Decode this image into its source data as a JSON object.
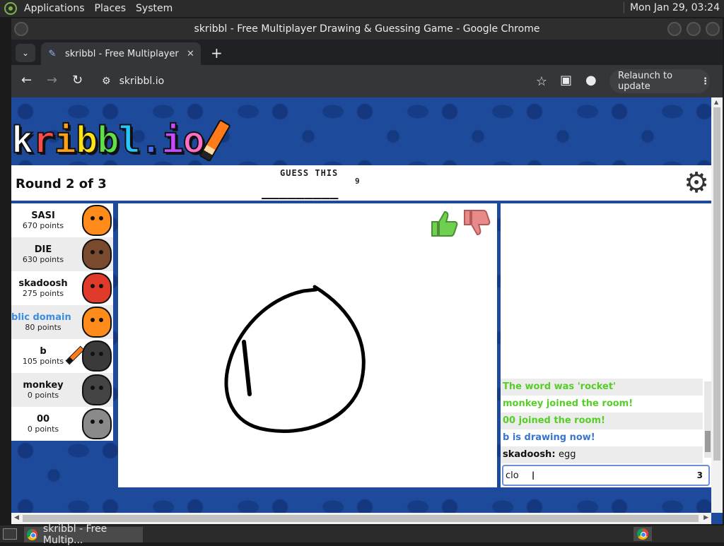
{
  "os_panel": {
    "menus": [
      "Applications",
      "Places",
      "System"
    ],
    "clock": "Mon Jan 29, 03:24"
  },
  "window": {
    "title": "skribbl - Free Multiplayer Drawing & Guessing Game - Google Chrome"
  },
  "tab": {
    "title": "skribbl - Free Multiplayer Dr",
    "favicon": "feather-icon"
  },
  "toolbar": {
    "url": "skribbl.io",
    "relaunch_label": "Relaunch to update"
  },
  "game": {
    "logo_text": "kribbl.io",
    "round_label": "Round 2 of 3",
    "guess_label": "GUESS THIS",
    "word_hint": "_________",
    "word_length": "9",
    "players": [
      {
        "name": "SASI",
        "points": "670 points",
        "color": "#ff8c1a",
        "you": false,
        "drawing": false
      },
      {
        "name": "DIE",
        "points": "630 points",
        "color": "#7a4a2e",
        "you": false,
        "drawing": false
      },
      {
        "name": "skadoosh",
        "points": "275 points",
        "color": "#e03a2a",
        "you": false,
        "drawing": false
      },
      {
        "name": "blic domain (You",
        "points": "80 points",
        "color": "#ff8c1a",
        "you": true,
        "drawing": false
      },
      {
        "name": "b",
        "points": "105 points",
        "color": "#3a3a3a",
        "you": false,
        "drawing": true
      },
      {
        "name": "monkey",
        "points": "0 points",
        "color": "#444444",
        "you": false,
        "drawing": false
      },
      {
        "name": "00",
        "points": "0 points",
        "color": "#8a8a8a",
        "you": false,
        "drawing": false
      }
    ],
    "chat": [
      {
        "text": "The word was 'rocket'",
        "style": "green",
        "author": ""
      },
      {
        "text": "monkey joined the room!",
        "style": "green",
        "author": ""
      },
      {
        "text": "00 joined the room!",
        "style": "green",
        "author": ""
      },
      {
        "text": "b is drawing now!",
        "style": "blue",
        "author": ""
      },
      {
        "text": "egg",
        "style": "dark",
        "author": "skadoosh:"
      }
    ],
    "chat_input_value": "clo",
    "chat_input_count": "3"
  },
  "taskbar": {
    "item_label": "skribbl - Free Multip..."
  }
}
